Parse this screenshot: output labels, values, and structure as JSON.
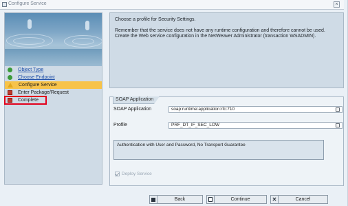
{
  "window": {
    "title": "Configure Service"
  },
  "steps": [
    {
      "label": "Object Type",
      "state": "done"
    },
    {
      "label": "Choose Endpoint",
      "state": "done"
    },
    {
      "label": "Configure Service",
      "state": "current"
    },
    {
      "label": "Enter Package/Request",
      "state": "pending"
    },
    {
      "label": "Complete",
      "state": "pending"
    }
  ],
  "info": {
    "line1": "Choose a profile for Security Settings.",
    "line2": "Remember that the service does not have any runtime configuration and therefore cannot be used. Create the Web service configuration in the NetWeaver Administrator (transaction WSADMIN)."
  },
  "soap": {
    "section_title": "SOAP Application",
    "app_label": "SOAP Application",
    "app_value": "soap:runtime:application:rfc:710",
    "profile_label": "Profile",
    "profile_value": "PRF_DT_IF_SEC_LOW",
    "description": "Authentication with User and Password, No Transport Guarantee",
    "deploy_label": "Deploy Service"
  },
  "buttons": {
    "back": "Back",
    "continue": "Continue",
    "cancel": "Cancel"
  }
}
